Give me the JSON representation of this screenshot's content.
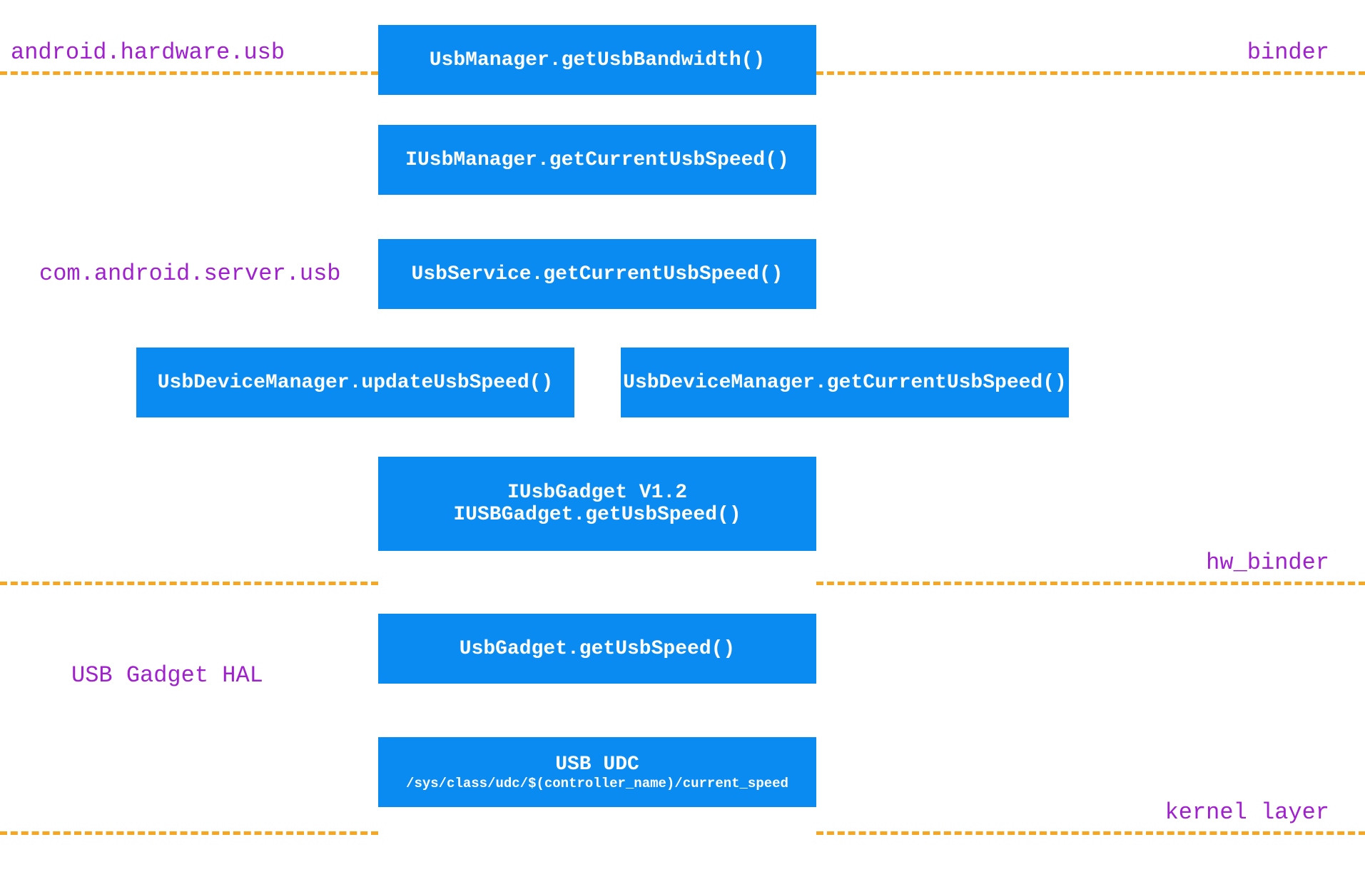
{
  "layers": {
    "binder_label": "binder",
    "hw_binder_label": "hw_binder",
    "kernel_layer_label": "kernel layer"
  },
  "packages": {
    "android_hardware_usb": "android.hardware.usb",
    "com_android_server_usb": "com.android.server.usb",
    "usb_gadget_hal": "USB Gadget HAL"
  },
  "boxes": {
    "b1": "UsbManager.getUsbBandwidth()",
    "b2": "IUsbManager.getCurrentUsbSpeed()",
    "b3": "UsbService.getCurrentUsbSpeed()",
    "b4a": "UsbDeviceManager.updateUsbSpeed()",
    "b4b": "UsbDeviceManager.getCurrentUsbSpeed()",
    "b5_line1": "IUsbGadget V1.2",
    "b5_line2": "IUSBGadget.getUsbSpeed()",
    "b6": "UsbGadget.getUsbSpeed()",
    "b7_title": "USB UDC",
    "b7_sub": "/sys/class/udc/$(controller_name)/current_speed"
  }
}
